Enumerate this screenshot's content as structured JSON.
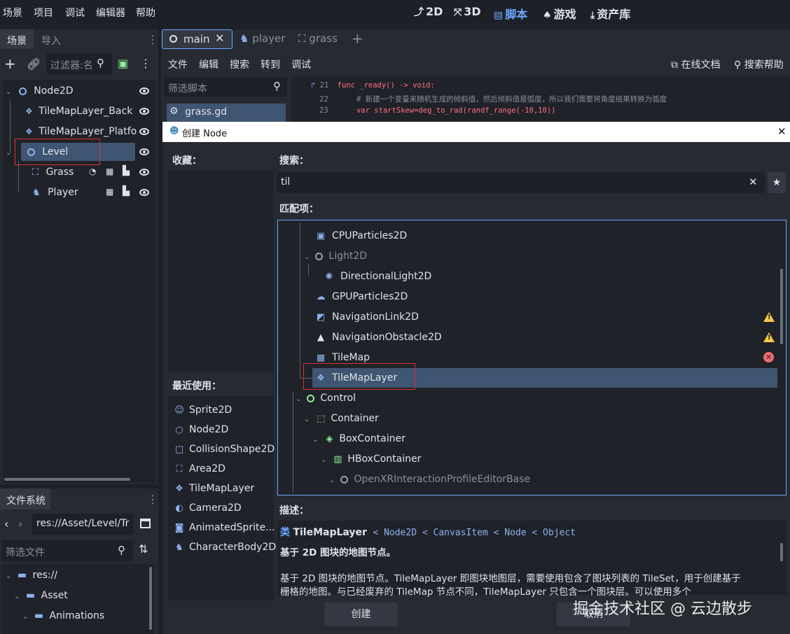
{
  "menu": [
    "场景",
    "项目",
    "调试",
    "编辑器",
    "帮助"
  ],
  "modes": [
    {
      "icon": "⤴",
      "label": "2D"
    },
    {
      "icon": "⤧",
      "label": "3D"
    },
    {
      "icon": "▤",
      "label": "脚本"
    },
    {
      "icon": "♠",
      "label": "游戏"
    },
    {
      "icon": "⤓",
      "label": "资产库"
    }
  ],
  "scene_dock": {
    "tabs": [
      "场景",
      "导入"
    ],
    "filter_placeholder": "过滤器:名",
    "tree": [
      {
        "label": "Node2D"
      },
      {
        "label": "TileMapLayer_Back"
      },
      {
        "label": "TileMapLayer_Platfo"
      },
      {
        "label": "Level"
      },
      {
        "label": "Grass"
      },
      {
        "label": "Player"
      }
    ]
  },
  "fs_dock": {
    "title": "文件系统",
    "path": "res://Asset/Level/Tr",
    "filter_placeholder": "筛选文件",
    "tree": [
      "res://",
      "Asset",
      "Animations"
    ]
  },
  "script_tabs": [
    "main",
    "player",
    "grass"
  ],
  "script_menu": [
    "文件",
    "编辑",
    "搜索",
    "转到",
    "调试"
  ],
  "script_links": [
    "在线文档",
    "搜索帮助"
  ],
  "script_filter": "筛选脚本",
  "script_list": [
    "grass.gd"
  ],
  "code": [
    {
      "line": "21",
      "text": "func _ready() -> void:"
    },
    {
      "line": "22",
      "text": "# 新建一个变量来随机生成的倾斜值，然后倾斜值是弧度，所以我们需要将角度结果转换为弧度"
    },
    {
      "line": "23",
      "text": "var startSkew=deg_to_rad(randf_range(-10,10))"
    }
  ],
  "dialog": {
    "title": "创建 Node",
    "favorites_label": "收藏：",
    "recent_label": "最近使用：",
    "recent": [
      "Sprite2D",
      "Node2D",
      "CollisionShape2D",
      "Area2D",
      "TileMapLayer",
      "Camera2D",
      "AnimatedSprite...",
      "CharacterBody2D"
    ],
    "search_label": "搜索：",
    "search_value": "til",
    "matches_label": "匹配项：",
    "matches": [
      "CPUParticles2D",
      "Light2D",
      "DirectionalLight2D",
      "GPUParticles2D",
      "NavigationLink2D",
      "NavigationObstacle2D",
      "TileMap",
      "TileMapLayer",
      "Control",
      "Container",
      "BoxContainer",
      "HBoxContainer",
      "OpenXRInteractionProfileEditorBase"
    ],
    "desc_label": "描述：",
    "desc_class_prefix": "类",
    "desc_class": "TileMapLayer",
    "desc_inherit": "< Node2D < CanvasItem < Node < Object",
    "desc_summary": "基于 2D 图块的地图节点。",
    "desc_body_1": "基于 2D 图块的地图节点。TileMapLayer 即图块地图层，需要使用包含了图块列表的 TileSet，用于创建基于",
    "desc_body_2": "栅格的地图。与已经废弃的 TileMap 节点不同，TileMapLayer 只包含一个图块层。可以使用多个",
    "create_button": "创建",
    "cancel_button": "取消"
  },
  "watermark": "掘金技术社区 @ 云边散步",
  "colors": {
    "accent": "#6fa8ff",
    "background": "#1d2026",
    "panel": "#262a31",
    "selection": "#3f5571",
    "highlight_box": "#e03030"
  }
}
